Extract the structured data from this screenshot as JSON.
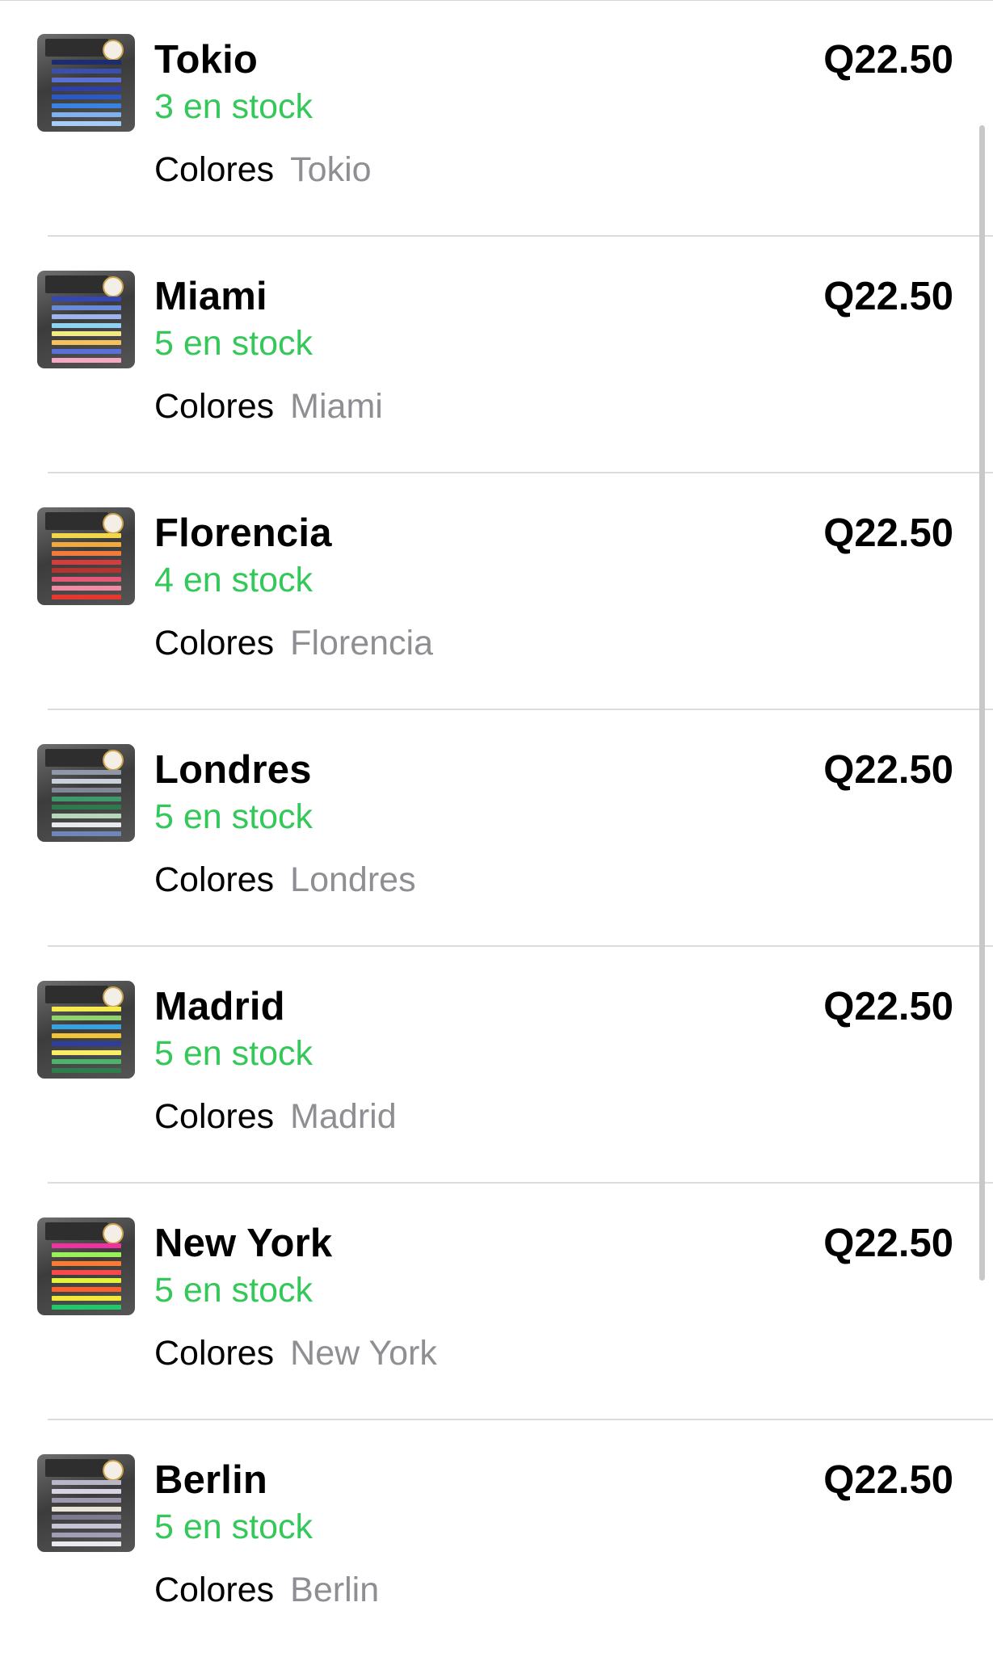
{
  "products": [
    {
      "name": "Tokio",
      "stock": "3 en stock",
      "price": "Q22.50",
      "attr_label": "Colores",
      "attr_value": "Tokio",
      "thumbnail_icon": "product-thumbnail",
      "strip_colors": [
        "#1d2c6e",
        "#3a4fb0",
        "#5d6fd0",
        "#2f3fa8",
        "#2a5ac8",
        "#3a82e0",
        "#7fb2ef",
        "#a7cdf4"
      ]
    },
    {
      "name": "Miami",
      "stock": "5 en stock",
      "price": "Q22.50",
      "attr_label": "Colores",
      "attr_value": "Miami",
      "thumbnail_icon": "product-thumbnail",
      "strip_colors": [
        "#3447b7",
        "#6a8ad6",
        "#9db4ee",
        "#8fd3f2",
        "#f2ea85",
        "#f6c15b",
        "#5b6fd8",
        "#f5a7c4"
      ]
    },
    {
      "name": "Florencia",
      "stock": "4 en stock",
      "price": "Q22.50",
      "attr_label": "Colores",
      "attr_value": "Florencia",
      "thumbnail_icon": "product-thumbnail",
      "strip_colors": [
        "#f1d64b",
        "#f2a93b",
        "#f27a3a",
        "#d83b3b",
        "#b8332f",
        "#e45a76",
        "#f28aa5",
        "#e3382f"
      ]
    },
    {
      "name": "Londres",
      "stock": "5 en stock",
      "price": "Q22.50",
      "attr_label": "Colores",
      "attr_value": "Londres",
      "thumbnail_icon": "product-thumbnail",
      "strip_colors": [
        "#8f97a8",
        "#c9d0dc",
        "#7f8798",
        "#3e9a6a",
        "#2d7a4f",
        "#b5d9b8",
        "#e6e9ee",
        "#6f86b8"
      ]
    },
    {
      "name": "Madrid",
      "stock": "5 en stock",
      "price": "Q22.50",
      "attr_label": "Colores",
      "attr_value": "Madrid",
      "thumbnail_icon": "product-thumbnail",
      "strip_colors": [
        "#f5ea4d",
        "#8fd36b",
        "#3aa0e0",
        "#f2c237",
        "#2e3d9e",
        "#f8ee68",
        "#4cb36a",
        "#2f7d4d"
      ]
    },
    {
      "name": "New York",
      "stock": "5 en stock",
      "price": "Q22.50",
      "attr_label": "Colores",
      "attr_value": "New York",
      "thumbnail_icon": "product-thumbnail",
      "strip_colors": [
        "#f032a0",
        "#9bf05a",
        "#ff7a2f",
        "#f84a4a",
        "#e3f53a",
        "#ff5f2c",
        "#f0e93a",
        "#1ec96b"
      ]
    },
    {
      "name": "Berlin",
      "stock": "5 en stock",
      "price": "Q22.50",
      "attr_label": "Colores",
      "attr_value": "Berlin",
      "thumbnail_icon": "product-thumbnail",
      "strip_colors": [
        "#b8b6c8",
        "#d8d2e4",
        "#9d9aaf",
        "#e8e2d8",
        "#7c7a90",
        "#c9c3d6",
        "#a29db6",
        "#ece8f0"
      ]
    }
  ],
  "colors": {
    "stock_green": "#34c759",
    "secondary_gray": "#8e8e93",
    "separator": "#dcdcdc"
  }
}
